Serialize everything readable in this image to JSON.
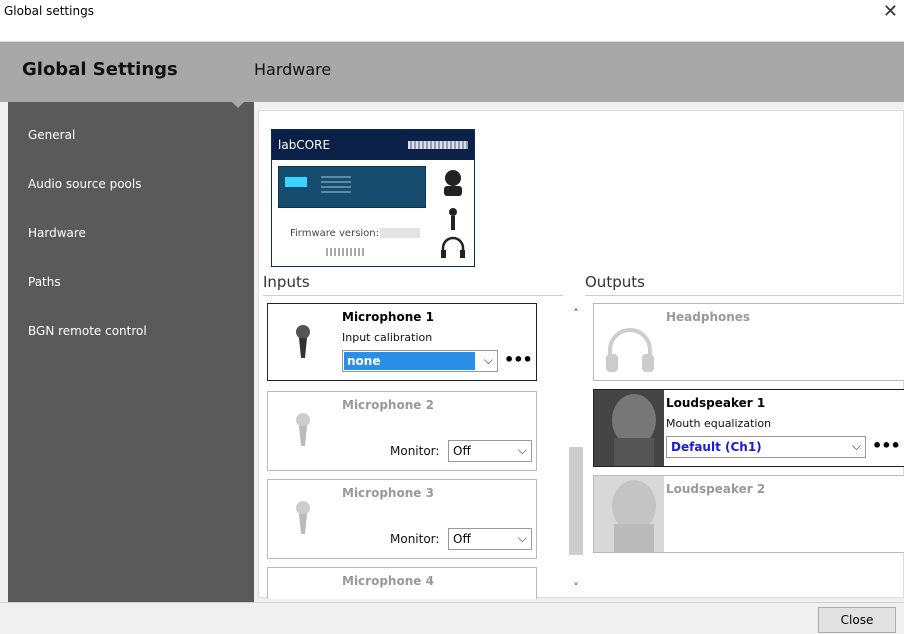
{
  "window": {
    "title": "Global settings"
  },
  "header": {
    "app_title": "Global Settings",
    "section_title": "Hardware"
  },
  "sidebar": {
    "items": [
      {
        "label": "General"
      },
      {
        "label": "Audio source pools"
      },
      {
        "label": "Hardware"
      },
      {
        "label": "Paths"
      },
      {
        "label": "BGN remote control"
      }
    ]
  },
  "device": {
    "name": "labCORE",
    "firmware_label": "Firmware version:"
  },
  "inputs": {
    "label": "Inputs",
    "items": [
      {
        "name": "Microphone 1",
        "calibration_label": "Input calibration",
        "calibration_value": "none"
      },
      {
        "name": "Microphone 2",
        "monitor_label": "Monitor:",
        "monitor_value": "Off"
      },
      {
        "name": "Microphone 3",
        "monitor_label": "Monitor:",
        "monitor_value": "Off"
      },
      {
        "name": "Microphone 4"
      }
    ]
  },
  "outputs": {
    "label": "Outputs",
    "items": [
      {
        "name": "Headphones"
      },
      {
        "name": "Loudspeaker 1",
        "eq_label": "Mouth equalization",
        "eq_value": "Default (Ch1)"
      },
      {
        "name": "Loudspeaker 2"
      }
    ]
  },
  "footer": {
    "close_label": "Close"
  },
  "icons": {
    "close": "close-icon",
    "chevron": "chevron-down-icon",
    "more": "more-icon",
    "mic": "microphone-icon",
    "headphones": "headphones-icon",
    "speaker": "loudspeaker-icon"
  },
  "colors": {
    "accent": "#2b8fe8",
    "sidebar": "#5a5a5a",
    "header": "#a8a8a8",
    "device_bar": "#0a2048"
  }
}
